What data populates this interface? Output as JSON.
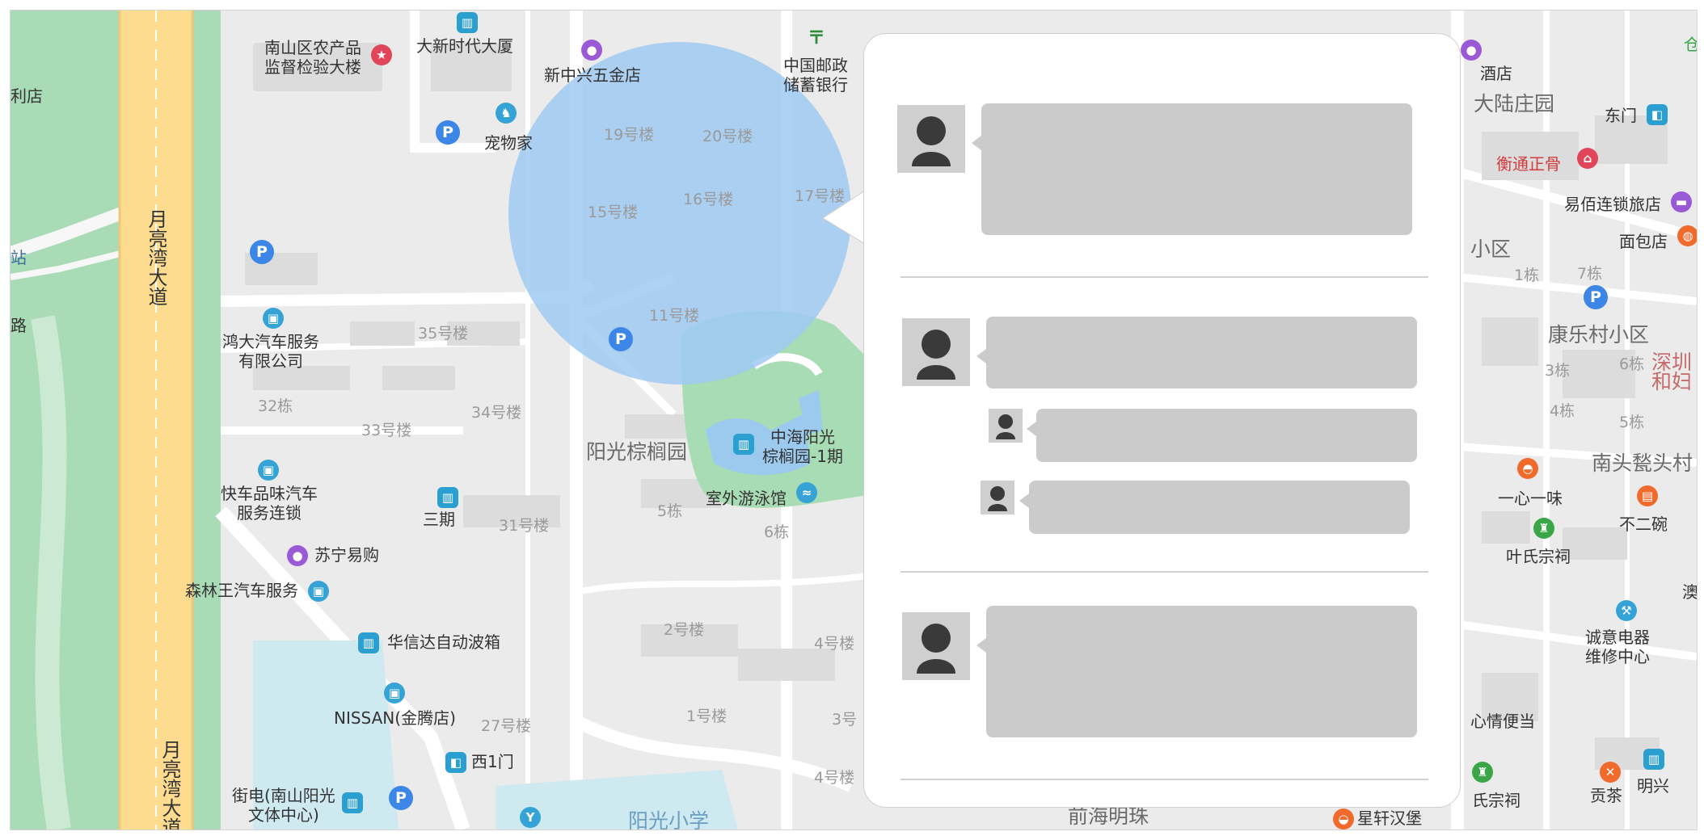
{
  "map": {
    "roads": {
      "moon_bay_upper": "月亮湾大道",
      "moon_bay_lower": "月亮湾大道"
    },
    "districts": [
      {
        "id": "yangguang",
        "text": "阳光棕榈园"
      },
      {
        "id": "dalu",
        "text": "大陆庄园"
      },
      {
        "id": "kangle",
        "text": "康乐村小区"
      },
      {
        "id": "nantou",
        "text": "南头甃头村"
      },
      {
        "id": "qianhai",
        "text": "前海明珠"
      },
      {
        "id": "xiaoqu",
        "text": "小区"
      },
      {
        "id": "xiaoxue",
        "text": "阳光小学"
      }
    ],
    "buildings": [
      {
        "id": "b19",
        "text": "19号楼"
      },
      {
        "id": "b20",
        "text": "20号楼"
      },
      {
        "id": "b15",
        "text": "15号楼"
      },
      {
        "id": "b16",
        "text": "16号楼"
      },
      {
        "id": "b17",
        "text": "17号楼"
      },
      {
        "id": "b11",
        "text": "11号楼"
      },
      {
        "id": "b35",
        "text": "35号楼"
      },
      {
        "id": "b34",
        "text": "34号楼"
      },
      {
        "id": "b33",
        "text": "33号楼"
      },
      {
        "id": "b32",
        "text": "32栋"
      },
      {
        "id": "b31",
        "text": "31号楼"
      },
      {
        "id": "b27",
        "text": "27号楼"
      },
      {
        "id": "b2",
        "text": "2号楼"
      },
      {
        "id": "b1",
        "text": "1号楼"
      },
      {
        "id": "b3",
        "text": "3号"
      },
      {
        "id": "b4a",
        "text": "4号楼"
      },
      {
        "id": "b4b",
        "text": "4号楼"
      },
      {
        "id": "d5",
        "text": "5栋"
      },
      {
        "id": "d6",
        "text": "6栋"
      },
      {
        "id": "r1",
        "text": "1栋"
      },
      {
        "id": "r7",
        "text": "7栋"
      },
      {
        "id": "r6",
        "text": "6栋"
      },
      {
        "id": "r3",
        "text": "3栋"
      },
      {
        "id": "r4",
        "text": "4栋"
      },
      {
        "id": "r5",
        "text": "5栋"
      }
    ],
    "places": [
      {
        "id": "nanshan_agri",
        "text": "南山区农产品\n监督检验大楼"
      },
      {
        "id": "daxin",
        "text": "大新时代大厦"
      },
      {
        "id": "xinzhongxing",
        "text": "新中兴五金店"
      },
      {
        "id": "postal_bank",
        "text": "中国邮政\n储蓄银行"
      },
      {
        "id": "pet_home",
        "text": "宠物家"
      },
      {
        "id": "hongda",
        "text": "鸿大汽车服务\n有限公司"
      },
      {
        "id": "kuaiche",
        "text": "快车品味汽车\n服务连锁"
      },
      {
        "id": "sanqi",
        "text": "三期"
      },
      {
        "id": "suning",
        "text": "苏宁易购"
      },
      {
        "id": "senlinwang",
        "text": "森林王汽车服务"
      },
      {
        "id": "huaxinda",
        "text": "华信达自动波箱"
      },
      {
        "id": "nissan",
        "text": "NISSAN(金腾店)"
      },
      {
        "id": "west_gate",
        "text": "西1门"
      },
      {
        "id": "jiedian",
        "text": "街电(南山阳光\n文体中心)"
      },
      {
        "id": "zhonghai",
        "text": "中海阳光\n棕榈园-1期"
      },
      {
        "id": "pool",
        "text": "室外游泳馆"
      },
      {
        "id": "hotel_right",
        "text": "酒店"
      },
      {
        "id": "east_gate",
        "text": "东门"
      },
      {
        "id": "hengtong",
        "text": "衡通正骨"
      },
      {
        "id": "yibai",
        "text": "易佰连锁旅店"
      },
      {
        "id": "bakery",
        "text": "面包店"
      },
      {
        "id": "shenzhen_fuyou",
        "text": "深圳\n和妇"
      },
      {
        "id": "yixin",
        "text": "一心一味"
      },
      {
        "id": "buerwan",
        "text": "不二碗"
      },
      {
        "id": "yeshi",
        "text": "叶氏宗祠"
      },
      {
        "id": "chengyi",
        "text": "诚意电器\n维修中心"
      },
      {
        "id": "xinqing",
        "text": "心情便当"
      },
      {
        "id": "gongcha",
        "text": "贡茶"
      },
      {
        "id": "mingxing",
        "text": "明兴"
      },
      {
        "id": "xingxuan",
        "text": "星轩汉堡"
      },
      {
        "id": "shi_zongci",
        "text": "氏宗祠"
      },
      {
        "id": "li_dian",
        "text": "利店"
      },
      {
        "id": "zhan",
        "text": "站"
      },
      {
        "id": "lu",
        "text": "路"
      },
      {
        "id": "ao",
        "text": "澳"
      },
      {
        "id": "cang",
        "text": "仓"
      }
    ],
    "overlays": {
      "radius_circle_color": "#9fcaf2",
      "park_color": "#a8dcb4",
      "water_color": "#9cc9ee",
      "road_color": "#fddb8f"
    }
  },
  "popup": {
    "threads": [
      {
        "messages": [
          {
            "size": "large"
          }
        ]
      },
      {
        "messages": [
          {
            "size": "large"
          },
          {
            "size": "small"
          },
          {
            "size": "small"
          }
        ]
      },
      {
        "messages": [
          {
            "size": "large"
          }
        ]
      }
    ]
  }
}
